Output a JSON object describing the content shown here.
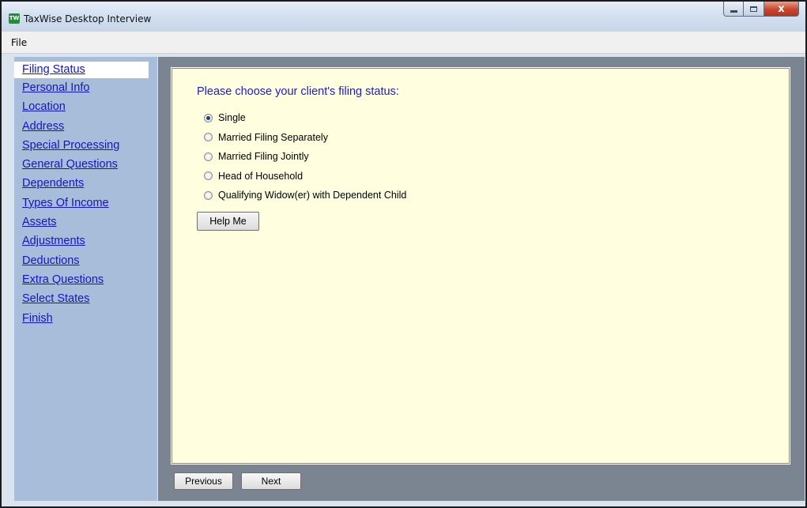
{
  "window": {
    "app_icon_text": "TW",
    "title": "TaxWise Desktop Interview",
    "close_glyph": "x",
    "controls": [
      "minimize-icon",
      "maximize-icon",
      "close-icon"
    ]
  },
  "menu": {
    "file": "File"
  },
  "sidebar": {
    "active_item": "Filing Status",
    "items": [
      {
        "label": "Filing Status"
      },
      {
        "label": "Personal Info"
      },
      {
        "label": "Location"
      },
      {
        "label": "Address"
      },
      {
        "label": "Special Processing"
      },
      {
        "label": "General Questions"
      },
      {
        "label": "Dependents"
      },
      {
        "label": "Types Of Income"
      },
      {
        "label": "Assets"
      },
      {
        "label": "Adjustments"
      },
      {
        "label": "Deductions"
      },
      {
        "label": "Extra Questions"
      },
      {
        "label": "Select States"
      },
      {
        "label": "Finish"
      }
    ]
  },
  "panel": {
    "prompt": "Please choose your client's filing status:",
    "selected_option": "Single",
    "options": [
      {
        "label": "Single",
        "checked": true
      },
      {
        "label": "Married Filing Separately",
        "checked": false
      },
      {
        "label": "Married Filing Jointly",
        "checked": false
      },
      {
        "label": "Head of Household",
        "checked": false
      },
      {
        "label": "Qualifying Widow(er) with Dependent Child",
        "checked": false
      }
    ],
    "help_button": "Help Me"
  },
  "footer": {
    "previous": "Previous",
    "next": "Next"
  },
  "colors": {
    "sidebar_bg": "#a8bdda",
    "link": "#1414c8",
    "panel_bg": "#ffffe0",
    "main_bg": "#7b8591",
    "prompt_text": "#1c1ccc"
  }
}
